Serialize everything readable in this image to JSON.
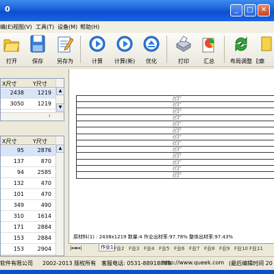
{
  "window": {
    "title": "0"
  },
  "menu": [
    "编(E)",
    "视图(V)",
    "工具(T)",
    "设备(M)",
    "帮助(H)"
  ],
  "toolbar": [
    "打开",
    "保存",
    "另存为",
    "计算",
    "计算(新)",
    "优化",
    "打印",
    "汇总",
    "布局调整",
    "轮廓"
  ],
  "table1": {
    "headers": [
      "X尺寸",
      "Y尺寸"
    ],
    "rows": [
      [
        "2438",
        "1219"
      ],
      [
        "3050",
        "1219"
      ]
    ]
  },
  "table2": {
    "headers": [
      "X尺寸",
      "Y尺寸"
    ],
    "rows": [
      [
        "95",
        "2876"
      ],
      [
        "137",
        "870"
      ],
      [
        "94",
        "2585"
      ],
      [
        "132",
        "470"
      ],
      [
        "101",
        "470"
      ],
      [
        "349",
        "490"
      ],
      [
        "310",
        "1614"
      ],
      [
        "171",
        "2884"
      ],
      [
        "153",
        "2884"
      ],
      [
        "153",
        "2904"
      ]
    ]
  },
  "canvas": {
    "strip_label": "3260\n614"
  },
  "info": {
    "text": "原材料(1) :  2438x1219   数量:4   作业出材率:97.78%   整体出材率:97.43%"
  },
  "tabs": [
    "作业1",
    "F业2",
    "F业3",
    "F业4",
    "F业5",
    "F业6",
    "F业7",
    "F业8",
    "F业9",
    "F业10",
    "F业11"
  ],
  "status": {
    "company": "软件有限公司",
    "copyright": "2002-2013 版权所有",
    "phone": "客服电话: 0531-88918889",
    "url": "http://www.queek.com",
    "last_edit": "(最后编辑时间 20"
  }
}
